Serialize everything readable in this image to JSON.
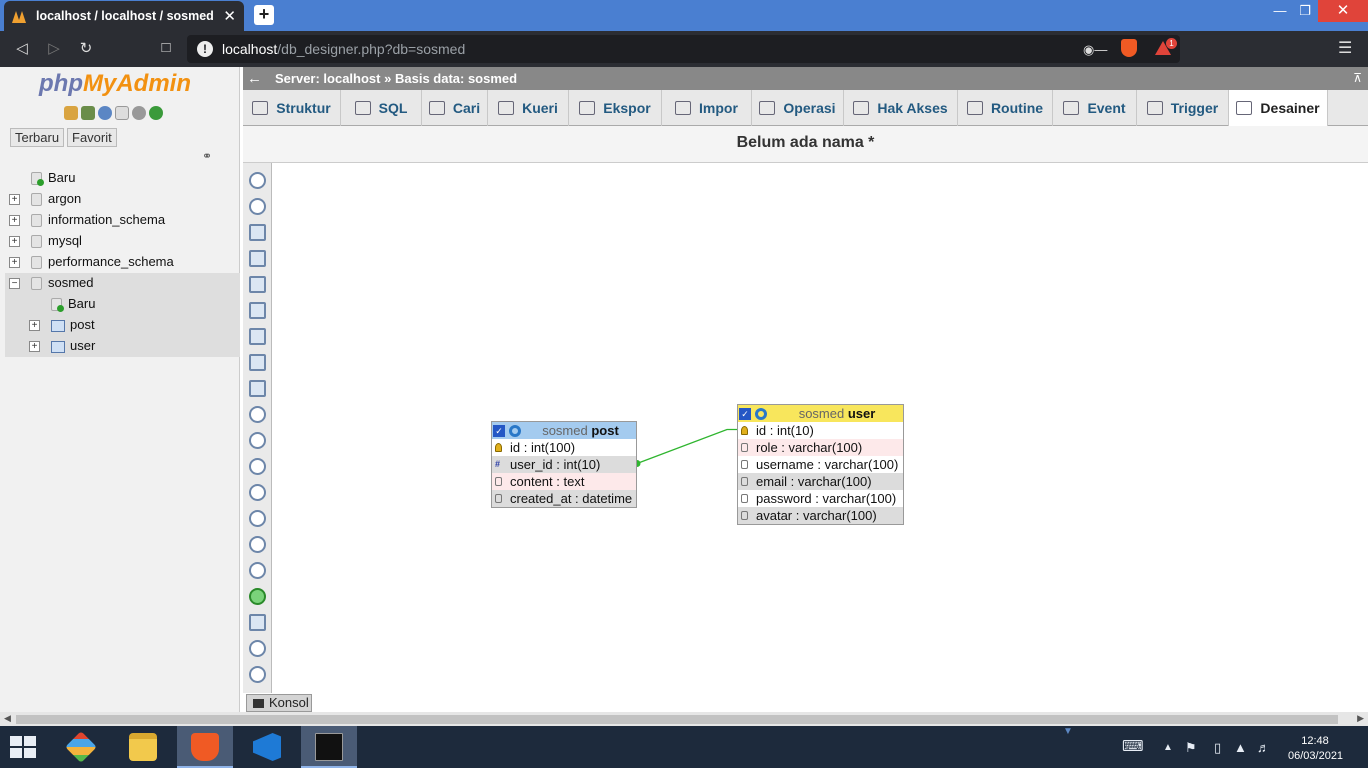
{
  "browser": {
    "tab_title": "localhost / localhost / sosmed | ph",
    "tab_close": "✕",
    "new_tab": "+",
    "url_host": "localhost",
    "url_path": "/db_designer.php?db=sosmed",
    "rewards_badge": "1",
    "minimize": "—",
    "restore": "❐",
    "close": "✕"
  },
  "pma": {
    "logo_php": "php",
    "logo_myadmin": "MyAdmin",
    "tab_recent": "Terbaru",
    "tab_favorites": "Favorit",
    "tree": [
      {
        "label": "Baru",
        "type": "new",
        "level": 0
      },
      {
        "label": "argon",
        "type": "db",
        "level": 0
      },
      {
        "label": "information_schema",
        "type": "db",
        "level": 0
      },
      {
        "label": "mysql",
        "type": "db",
        "level": 0
      },
      {
        "label": "performance_schema",
        "type": "db",
        "level": 0
      },
      {
        "label": "sosmed",
        "type": "db-open",
        "level": 0
      },
      {
        "label": "Baru",
        "type": "new",
        "level": 1
      },
      {
        "label": "post",
        "type": "table",
        "level": 1
      },
      {
        "label": "user",
        "type": "table",
        "level": 1
      }
    ],
    "breadcrumb_server": "Server: localhost",
    "breadcrumb_sep": "»",
    "breadcrumb_db": "Basis data: sosmed",
    "tabs": [
      "Struktur",
      "SQL",
      "Cari",
      "Kueri",
      "Ekspor",
      "Impor",
      "Operasi",
      "Hak Akses",
      "Routine",
      "Event",
      "Trigger",
      "Desainer"
    ],
    "active_tab": "Desainer",
    "page_title": "Belum ada nama *",
    "console_label": "Konsol"
  },
  "designer": {
    "tables": [
      {
        "db": "sosmed",
        "name": "post",
        "header_color": "#a4cbef",
        "fields": [
          {
            "text": "id : int(100)",
            "icon": "key"
          },
          {
            "text": "user_id : int(10)",
            "icon": "index"
          },
          {
            "text": "content : text",
            "icon": "field"
          },
          {
            "text": "created_at : datetime",
            "icon": "field"
          }
        ]
      },
      {
        "db": "sosmed",
        "name": "user",
        "header_color": "#f8e65c",
        "fields": [
          {
            "text": "id : int(10)",
            "icon": "key"
          },
          {
            "text": "role : varchar(100)",
            "icon": "field"
          },
          {
            "text": "username : varchar(100)",
            "icon": "field"
          },
          {
            "text": "email : varchar(100)",
            "icon": "field"
          },
          {
            "text": "password : varchar(100)",
            "icon": "field"
          },
          {
            "text": "avatar : varchar(100)",
            "icon": "field"
          }
        ]
      }
    ],
    "relation": {
      "from": "post.user_id",
      "to": "user.id",
      "color": "#2fb52f"
    }
  },
  "taskbar": {
    "time": "12:48",
    "date": "06/03/2021"
  }
}
